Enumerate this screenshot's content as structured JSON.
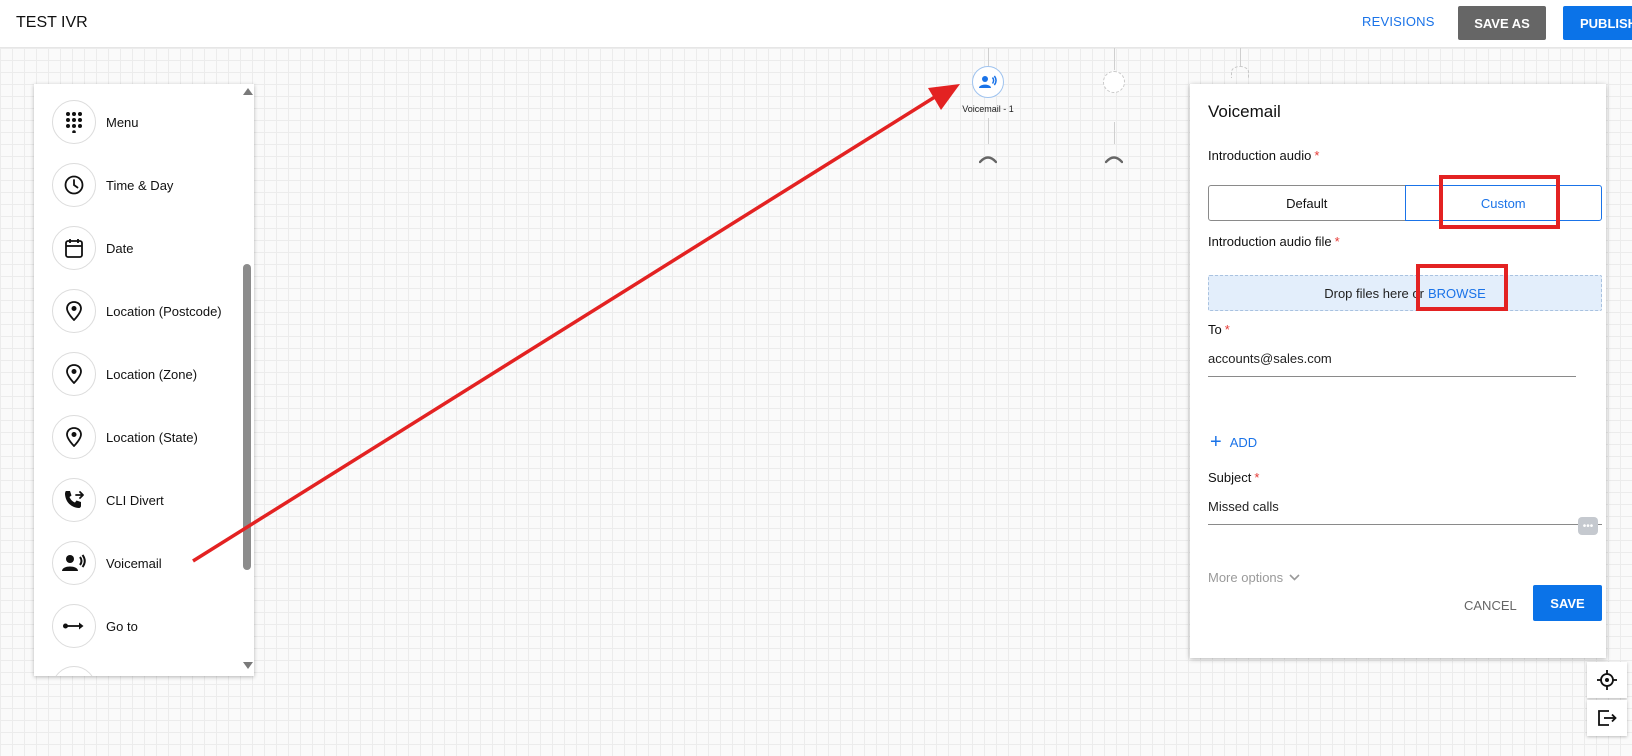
{
  "header": {
    "title": "TEST IVR",
    "revisions_label": "REVISIONS",
    "save_as_label": "SAVE AS",
    "publish_label": "PUBLISH"
  },
  "palette": {
    "items": [
      {
        "label": "Menu",
        "icon": "dialpad-icon"
      },
      {
        "label": "Time & Day",
        "icon": "clock-icon"
      },
      {
        "label": "Date",
        "icon": "calendar-icon"
      },
      {
        "label": "Location (Postcode)",
        "icon": "location-pin-icon"
      },
      {
        "label": "Location (Zone)",
        "icon": "location-pin-icon"
      },
      {
        "label": "Location (State)",
        "icon": "location-pin-icon"
      },
      {
        "label": "CLI Divert",
        "icon": "phone-forward-icon"
      },
      {
        "label": "Voicemail",
        "icon": "voicemail-icon"
      },
      {
        "label": "Go to",
        "icon": "goto-arrow-icon"
      }
    ]
  },
  "flow": {
    "voicemail_node_label": "Voicemail - 1"
  },
  "voicemail_panel": {
    "title": "Voicemail",
    "intro_audio_label": "Introduction audio",
    "intro_audio_options": [
      "Default",
      "Custom"
    ],
    "intro_audio_selected": "Custom",
    "intro_audio_file_label": "Introduction audio file",
    "dropzone_text": "Drop files here or",
    "browse_label": "BROWSE",
    "to_label": "To",
    "to_value": "accounts@sales.com",
    "add_label": "ADD",
    "subject_label": "Subject",
    "subject_value": "Missed calls",
    "more_options_label": "More options",
    "cancel_label": "CANCEL",
    "save_label": "SAVE",
    "required_mark": "*"
  },
  "colors": {
    "accent": "#0b73e8",
    "annotation": "#e32222",
    "save_as_bg": "#666666"
  }
}
